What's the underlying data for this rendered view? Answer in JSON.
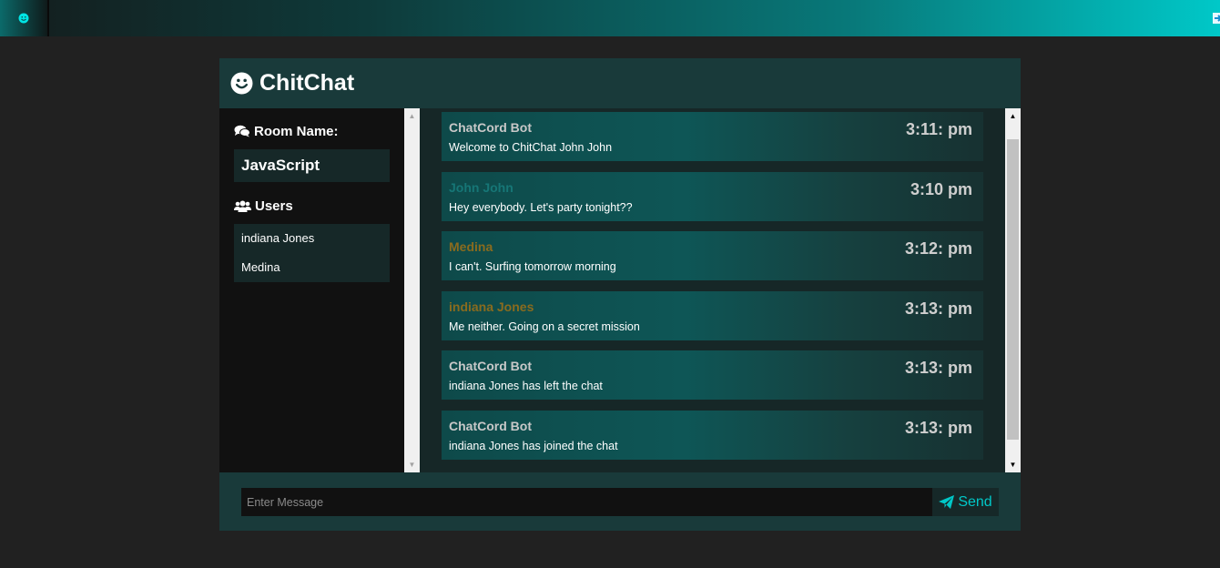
{
  "colors": {
    "accent": "#00c8c8",
    "header": "#193a3a",
    "sidebar": "#111111",
    "page": "#212121"
  },
  "header": {
    "title": "ChitChat",
    "logo_icon": "smile-icon"
  },
  "sidebar": {
    "room_heading": "Room Name:",
    "room_name": "JavaScript",
    "users_heading": "Users",
    "users": [
      "indiana Jones",
      "Medina"
    ]
  },
  "messages": [
    {
      "user": "ChatCord Bot",
      "time": "3:11: pm",
      "text": "Welcome to ChitChat John John",
      "name_color": "#c8c8c8"
    },
    {
      "user": "John John",
      "time": "3:10 pm",
      "text": "Hey everybody. Let's party tonight??",
      "name_color": "#167676"
    },
    {
      "user": "Medina",
      "time": "3:12: pm",
      "text": "I can't. Surfing tomorrow morning",
      "name_color": "#8a6b1e"
    },
    {
      "user": "indiana Jones",
      "time": "3:13: pm",
      "text": "Me neither. Going on a secret mission",
      "name_color": "#8a6b1e"
    },
    {
      "user": "ChatCord Bot",
      "time": "3:13: pm",
      "text": "indiana Jones has left the chat",
      "name_color": "#c8c8c8"
    },
    {
      "user": "ChatCord Bot",
      "time": "3:13: pm",
      "text": "indiana Jones has joined the chat",
      "name_color": "#c8c8c8"
    }
  ],
  "form": {
    "placeholder": "Enter Message",
    "send_label": "Send"
  }
}
